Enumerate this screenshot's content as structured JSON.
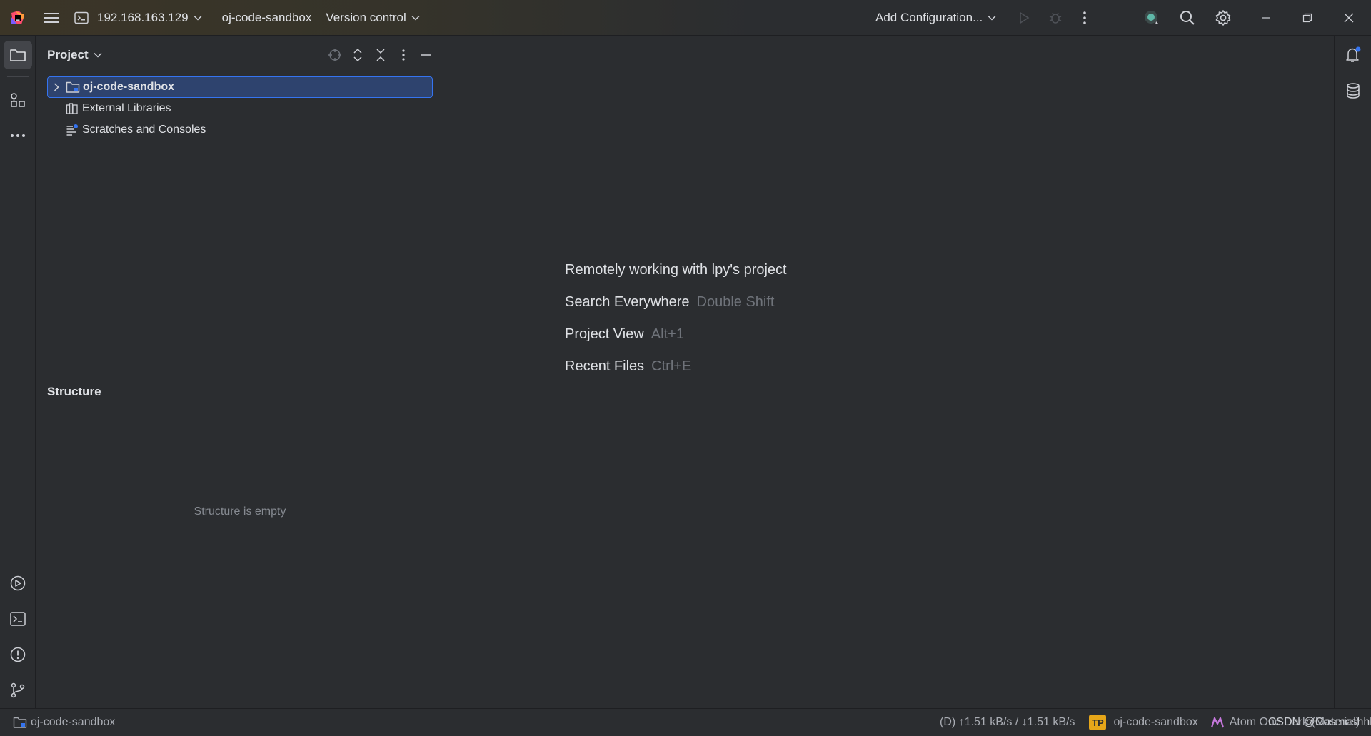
{
  "titlebar": {
    "host": "192.168.163.129",
    "project": "oj-code-sandbox",
    "vcs": "Version control",
    "run_config": "Add Configuration..."
  },
  "project_panel": {
    "title": "Project",
    "tree": [
      {
        "label": "oj-code-sandbox",
        "selected": true
      },
      {
        "label": "External Libraries"
      },
      {
        "label": "Scratches and Consoles"
      }
    ]
  },
  "structure_panel": {
    "title": "Structure",
    "empty_text": "Structure is empty"
  },
  "editor": {
    "hints": [
      {
        "text": "Remotely working with lpy's project",
        "key": ""
      },
      {
        "text": "Search Everywhere",
        "key": "Double Shift"
      },
      {
        "text": "Project View",
        "key": "Alt+1"
      },
      {
        "text": "Recent Files",
        "key": "Ctrl+E"
      }
    ]
  },
  "statusbar": {
    "project": "oj-code-sandbox",
    "network": "(D) ↑1.51 kB/s / ↓1.51 kB/s",
    "tp_badge": "TP",
    "tp_project": "oj-code-sandbox",
    "theme": "Atom One Dark (Material)",
    "watermark": "CSDN @Cosmoshhhyyy"
  },
  "colors": {
    "accent": "#3574f0",
    "selection": "#2e436e",
    "background": "#2b2d30",
    "badge": "#e6a619"
  }
}
